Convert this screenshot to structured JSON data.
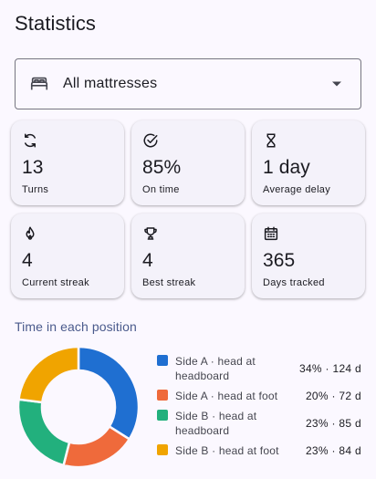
{
  "page": {
    "title": "Statistics"
  },
  "select": {
    "icon": "bed-icon",
    "value": "All mattresses",
    "caret": "chevron-down-icon"
  },
  "stats": [
    {
      "icon": "rotate-icon",
      "value": "13",
      "label": "Turns"
    },
    {
      "icon": "check-circle-icon",
      "value": "85%",
      "label": "On time"
    },
    {
      "icon": "hourglass-icon",
      "value": "1 day",
      "label": "Average delay"
    },
    {
      "icon": "flame-icon",
      "value": "4",
      "label": "Current streak"
    },
    {
      "icon": "trophy-icon",
      "value": "4",
      "label": "Best streak"
    },
    {
      "icon": "calendar-icon",
      "value": "365",
      "label": "Days tracked"
    }
  ],
  "section": {
    "title": "Time in each position"
  },
  "chart_data": {
    "type": "pie",
    "title": "Time in each position",
    "slices": [
      {
        "label": "Side A · head at headboard",
        "percent": 34,
        "days": 124,
        "color": "#1f6fd1"
      },
      {
        "label": "Side A · head at foot",
        "percent": 20,
        "days": 72,
        "color": "#ef6a3b"
      },
      {
        "label": "Side B · head at headboard",
        "percent": 23,
        "days": 85,
        "color": "#22b07d"
      },
      {
        "label": "Side B · head at foot",
        "percent": 23,
        "days": 84,
        "color": "#f0a400"
      }
    ]
  },
  "legend": [
    {
      "label": "Side A · head at headboard",
      "stat": "34% · 124 d"
    },
    {
      "label": "Side A · head at foot",
      "stat": "20% · 72 d"
    },
    {
      "label": "Side B · head at headboard",
      "stat": "23% · 85 d"
    },
    {
      "label": "Side B · head at foot",
      "stat": "23% · 84 d"
    }
  ]
}
